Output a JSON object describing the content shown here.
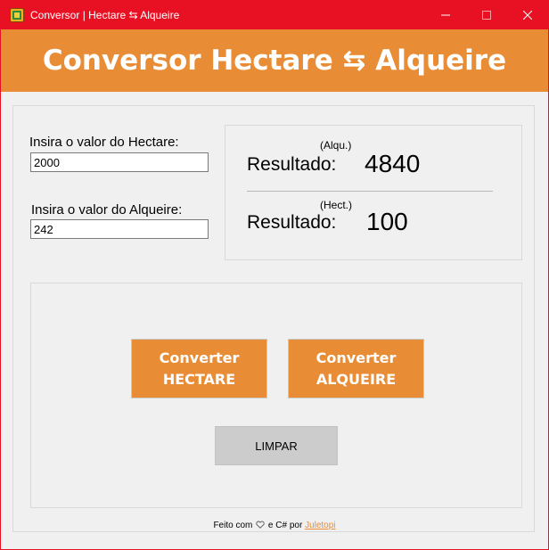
{
  "window": {
    "title": "Conversor | Hectare ⇆ Alqueire",
    "controls": {
      "minimize": "minimize-icon",
      "maximize": "maximize-icon",
      "close": "close-icon"
    }
  },
  "colors": {
    "titlebar": "#e81123",
    "accent": "#e88d35",
    "clear_button": "#cccccc"
  },
  "header": {
    "title": "Conversor Hectare ⇆ Alqueire"
  },
  "inputs": {
    "hectare": {
      "label": "Insira o valor do Hectare:",
      "value": "2000"
    },
    "alqueire": {
      "label": "Insira o valor do Alqueire:",
      "value": "242"
    }
  },
  "results": {
    "alqueire": {
      "unit": "(Alqu.)",
      "label": "Resultado:",
      "value": "4840"
    },
    "hectare": {
      "unit": "(Hect.)",
      "label": "Resultado:",
      "value": "100"
    }
  },
  "buttons": {
    "convert_hectare": {
      "line1": "Converter",
      "line2": "HECTARE"
    },
    "convert_alqueire": {
      "line1": "Converter",
      "line2": "ALQUEIRE"
    },
    "clear": "LIMPAR"
  },
  "footer": {
    "prefix": "Feito com",
    "heart_icon": "heart-icon",
    "middle": "e C# por",
    "author": "Juletopi"
  }
}
